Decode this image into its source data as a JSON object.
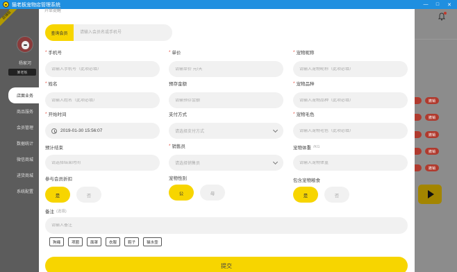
{
  "window": {
    "title": "猫老板宠物店管理系统",
    "minimize": "—",
    "maximize": "□",
    "close": "✕"
  },
  "sidebar": {
    "ribbon": "店铺版",
    "shop_name": "杨家河",
    "shop_tag": "某老板",
    "items": [
      {
        "label": "店面业务",
        "active": true
      },
      {
        "label": "商品服务"
      },
      {
        "label": "会员管理"
      },
      {
        "label": "数据统计"
      },
      {
        "label": "微信商城"
      },
      {
        "label": "进货商城"
      },
      {
        "label": "系统配置"
      }
    ]
  },
  "background": {
    "pill_label": "撤销"
  },
  "modal": {
    "top_text": "开单提醒",
    "member_search": {
      "button": "查询会员",
      "placeholder": "请输入会员名或手机号"
    },
    "fields": {
      "phone": {
        "label": "手机号",
        "required": true,
        "placeholder": "请输入手机号（此项必填）"
      },
      "price": {
        "label": "单价",
        "required": true,
        "placeholder": "请输单价 元/天"
      },
      "pet_name": {
        "label": "宠物昵称",
        "required": true,
        "placeholder": "请输入宠物昵称（此项必填）"
      },
      "name": {
        "label": "姓名",
        "required": true,
        "placeholder": "请输入姓名（此项必填）"
      },
      "deposit": {
        "label": "预存金额",
        "required": false,
        "placeholder": "请输预存金额"
      },
      "breed": {
        "label": "宠物品种",
        "required": true,
        "placeholder": "请输入宠物品种（此项必填）"
      },
      "start_time": {
        "label": "开始时间",
        "required": true,
        "value": "2019-01-30 15:56:07"
      },
      "payment": {
        "label": "支付方式",
        "required": false,
        "placeholder": "请选择支付方式"
      },
      "fur_color": {
        "label": "宠物毛色",
        "required": true,
        "placeholder": "请输入宠物毛色（此项必填）"
      },
      "end_time": {
        "label": "预计结束",
        "required": false,
        "placeholder": "请选择结束时间"
      },
      "salesperson": {
        "label": "销售员",
        "required": true,
        "placeholder": "请选择销售员"
      },
      "weight": {
        "label": "宠物体重",
        "unit": "/KG",
        "required": false,
        "placeholder": "请输入宠物体重"
      }
    },
    "toggles": {
      "member_discount": {
        "label": "参与会员折扣",
        "yes": "是",
        "no": "否",
        "selected": "是"
      },
      "gender": {
        "label": "宠物性别",
        "male": "公",
        "female": "母",
        "selected": "公"
      },
      "food": {
        "label": "包含宠物粮食",
        "yes": "是",
        "no": "否",
        "selected": "是"
      }
    },
    "remark": {
      "label": "备注",
      "hint": "(选填)",
      "placeholder": "请输入备注"
    },
    "chips": [
      "狗绳",
      "项圈",
      "面罩",
      "衣服",
      "鞋子",
      "猫水壶"
    ],
    "submit": "提交"
  },
  "colors": {
    "accent": "#f7d500",
    "titlebar": "#1f8fe0",
    "required": "#e74c3c",
    "field_bg": "#f1f1f1"
  }
}
